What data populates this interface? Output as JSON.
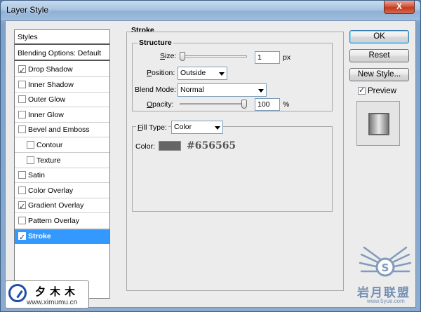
{
  "window": {
    "title": "Layer Style",
    "close_glyph": "X"
  },
  "styles": {
    "header": "Styles",
    "blending": "Blending Options: Default",
    "items": [
      {
        "label": "Drop Shadow",
        "checked": true,
        "sub": false,
        "selected": false
      },
      {
        "label": "Inner Shadow",
        "checked": false,
        "sub": false,
        "selected": false
      },
      {
        "label": "Outer Glow",
        "checked": false,
        "sub": false,
        "selected": false
      },
      {
        "label": "Inner Glow",
        "checked": false,
        "sub": false,
        "selected": false
      },
      {
        "label": "Bevel and Emboss",
        "checked": false,
        "sub": false,
        "selected": false
      },
      {
        "label": "Contour",
        "checked": false,
        "sub": true,
        "selected": false
      },
      {
        "label": "Texture",
        "checked": false,
        "sub": true,
        "selected": false
      },
      {
        "label": "Satin",
        "checked": false,
        "sub": false,
        "selected": false
      },
      {
        "label": "Color Overlay",
        "checked": false,
        "sub": false,
        "selected": false
      },
      {
        "label": "Gradient Overlay",
        "checked": true,
        "sub": false,
        "selected": false
      },
      {
        "label": "Pattern Overlay",
        "checked": false,
        "sub": false,
        "selected": false
      },
      {
        "label": "Stroke",
        "checked": true,
        "sub": false,
        "selected": true
      }
    ]
  },
  "stroke": {
    "section_title": "Stroke",
    "structure_title": "Structure",
    "size_label_u": "S",
    "size_label_rest": "ize:",
    "size_value": "1",
    "size_unit": "px",
    "size_slider_fraction": 0.0,
    "position_label_u": "P",
    "position_label_rest": "osition:",
    "position_value": "Outside",
    "blend_label": "Blend Mode:",
    "blend_value": "Normal",
    "opacity_label_u": "O",
    "opacity_label_rest": "pacity:",
    "opacity_value": "100",
    "opacity_unit": "%",
    "opacity_slider_fraction": 1.0,
    "fill_type_label_u": "F",
    "fill_type_label_rest": "ill Type:",
    "fill_type_value": "Color",
    "color_label": "Color:",
    "color_hex_text": "#656565",
    "color_swatch": "#656565"
  },
  "buttons": {
    "ok": "OK",
    "reset": "Reset",
    "new_style": "New Style...",
    "preview_label": "Preview",
    "preview_checked": true
  },
  "watermark_left": {
    "cn": "夕木木",
    "url": "www.ximumu.cn"
  },
  "watermark_right": {
    "cn": "岩月联盟",
    "url": "www.5yue.com"
  }
}
